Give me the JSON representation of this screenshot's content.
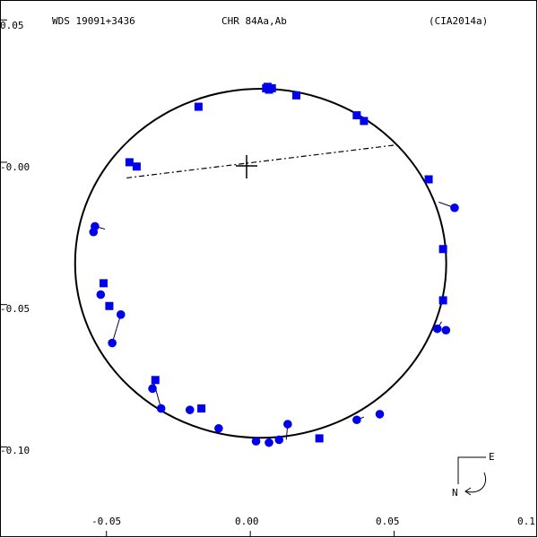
{
  "chart_data": {
    "type": "scatter",
    "header": {
      "left": "WDS 19091+3436",
      "center": "CHR  84Aa,Ab",
      "right": "(CIA2014a)"
    },
    "x_ticks": [
      "-0.05",
      "0.00",
      "0.05",
      "0.1"
    ],
    "y_ticks": [
      "0.05",
      "-0.00",
      "-0.05",
      "-0.10"
    ],
    "xlim": [
      -0.087,
      0.1
    ],
    "ylim": [
      -0.132,
      0.057
    ],
    "orbit": {
      "center": [
        0.0036,
        -0.0355
      ],
      "a": 0.0645,
      "b": 0.0613
    },
    "node_line": {
      "start": [
        -0.043,
        -0.0055
      ],
      "end": [
        0.05,
        0.006
      ]
    },
    "compass": {
      "east_label": "E",
      "north_label": "N"
    },
    "square_points": [
      [
        0.006,
        0.0265
      ],
      [
        0.0055,
        0.026
      ],
      [
        0.0075,
        0.026
      ],
      [
        0.0065,
        0.0255
      ],
      [
        0.016,
        0.0235
      ],
      [
        -0.018,
        0.0195
      ],
      [
        0.037,
        0.0165
      ],
      [
        0.0395,
        0.0145
      ],
      [
        -0.042,
        0.0
      ],
      [
        -0.0395,
        -0.0015
      ],
      [
        0.062,
        -0.006
      ],
      [
        0.067,
        -0.0305
      ],
      [
        0.067,
        -0.0485
      ],
      [
        -0.051,
        -0.0425
      ],
      [
        -0.049,
        -0.0505
      ],
      [
        -0.033,
        -0.0765
      ],
      [
        -0.017,
        -0.0865
      ],
      [
        0.024,
        -0.097
      ]
    ],
    "circle_points": [
      [
        0.071,
        -0.016
      ],
      [
        -0.054,
        -0.0225
      ],
      [
        -0.0545,
        -0.0245
      ],
      [
        -0.052,
        -0.0465
      ],
      [
        -0.045,
        -0.0535
      ],
      [
        -0.048,
        -0.0635
      ],
      [
        0.065,
        -0.0585
      ],
      [
        0.068,
        -0.059
      ],
      [
        -0.034,
        -0.0795
      ],
      [
        -0.031,
        -0.0865
      ],
      [
        -0.021,
        -0.087
      ],
      [
        -0.011,
        -0.0935
      ],
      [
        0.002,
        -0.098
      ],
      [
        0.0065,
        -0.0985
      ],
      [
        0.01,
        -0.0975
      ],
      [
        0.013,
        -0.092
      ],
      [
        0.037,
        -0.0905
      ],
      [
        0.045,
        -0.0885
      ]
    ],
    "residuals": [
      [
        0.071,
        -0.016,
        0.0655,
        -0.014
      ],
      [
        -0.054,
        -0.0225,
        -0.0505,
        -0.0235
      ],
      [
        -0.045,
        -0.0535,
        -0.0465,
        -0.0585
      ],
      [
        -0.048,
        -0.0635,
        -0.0465,
        -0.0585
      ],
      [
        -0.034,
        -0.0795,
        -0.0335,
        -0.0775
      ],
      [
        -0.031,
        -0.0865,
        -0.0335,
        -0.0775
      ],
      [
        0.065,
        -0.0585,
        0.0665,
        -0.056
      ],
      [
        0.013,
        -0.092,
        0.0125,
        -0.0975
      ],
      [
        0.037,
        -0.0905,
        0.0395,
        -0.0895
      ]
    ]
  }
}
